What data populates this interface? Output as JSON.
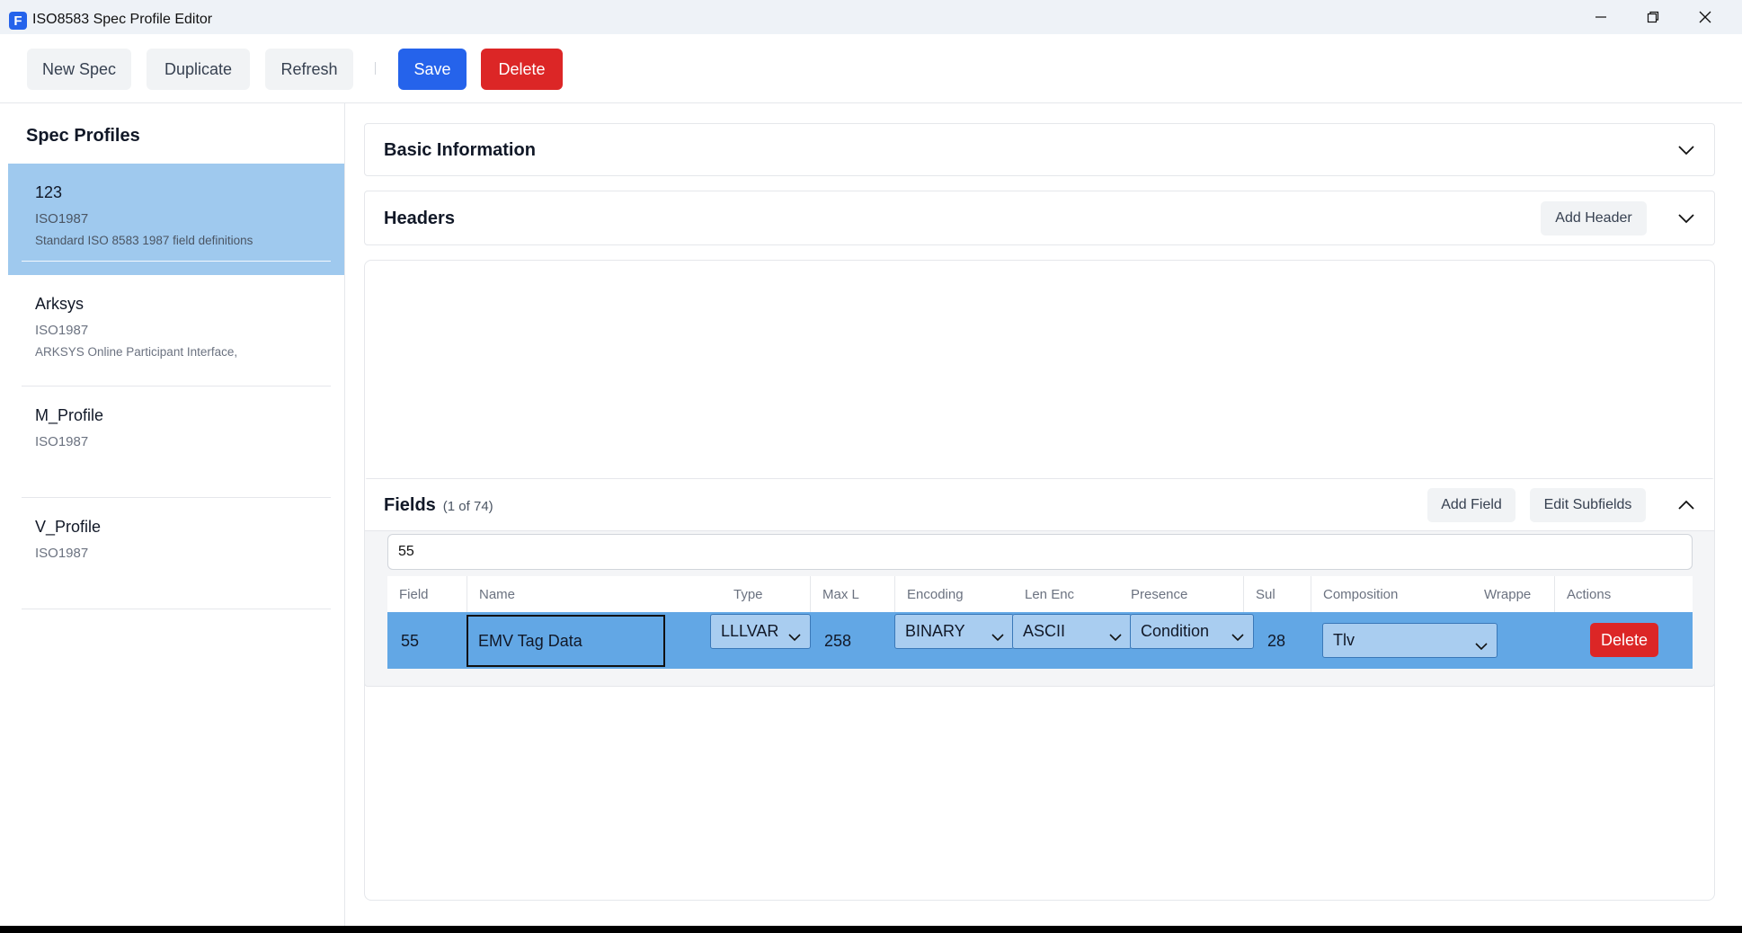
{
  "window": {
    "app_icon_letter": "F",
    "title": "ISO8583 Spec Profile Editor"
  },
  "toolbar": {
    "new_spec": "New Spec",
    "duplicate": "Duplicate",
    "refresh": "Refresh",
    "save": "Save",
    "delete": "Delete"
  },
  "sidebar": {
    "title": "Spec Profiles",
    "items": [
      {
        "name": "123",
        "standard": "ISO1987",
        "description": "Standard ISO 8583 1987 field definitions",
        "selected": true
      },
      {
        "name": "Arksys",
        "standard": "ISO1987",
        "description": "ARKSYS Online Participant Interface,",
        "selected": false
      },
      {
        "name": "M_Profile",
        "standard": "ISO1987",
        "description": "",
        "selected": false
      },
      {
        "name": "V_Profile",
        "standard": "ISO1987",
        "description": "",
        "selected": false
      }
    ]
  },
  "main": {
    "basic_info": {
      "title": "Basic Information",
      "expanded": false
    },
    "headers": {
      "title": "Headers",
      "add_button": "Add Header",
      "expanded": false
    },
    "fields": {
      "title": "Fields",
      "count_text": "(1 of 74)",
      "add_button": "Add Field",
      "edit_subfields_button": "Edit Subfields",
      "expanded": true,
      "search_value": "55",
      "columns": [
        "Field",
        "Name",
        "Type",
        "Max L",
        "Encoding",
        "Len Enc",
        "Presence",
        "Sul",
        "Composition",
        "Wrappe",
        "Actions"
      ],
      "rows": [
        {
          "field": "55",
          "name": "EMV Tag Data",
          "type": "LLLVAR",
          "max_len": "258",
          "encoding": "BINARY",
          "len_enc": "ASCII",
          "presence": "Condition",
          "sub": "28",
          "composition": "Tlv",
          "wrapper": "",
          "action": "Delete"
        }
      ]
    }
  },
  "colors": {
    "accent_blue": "#2563eb",
    "danger_red": "#dc2626",
    "selected_row": "#62a7e5",
    "selected_profile": "#9fc9ee"
  }
}
